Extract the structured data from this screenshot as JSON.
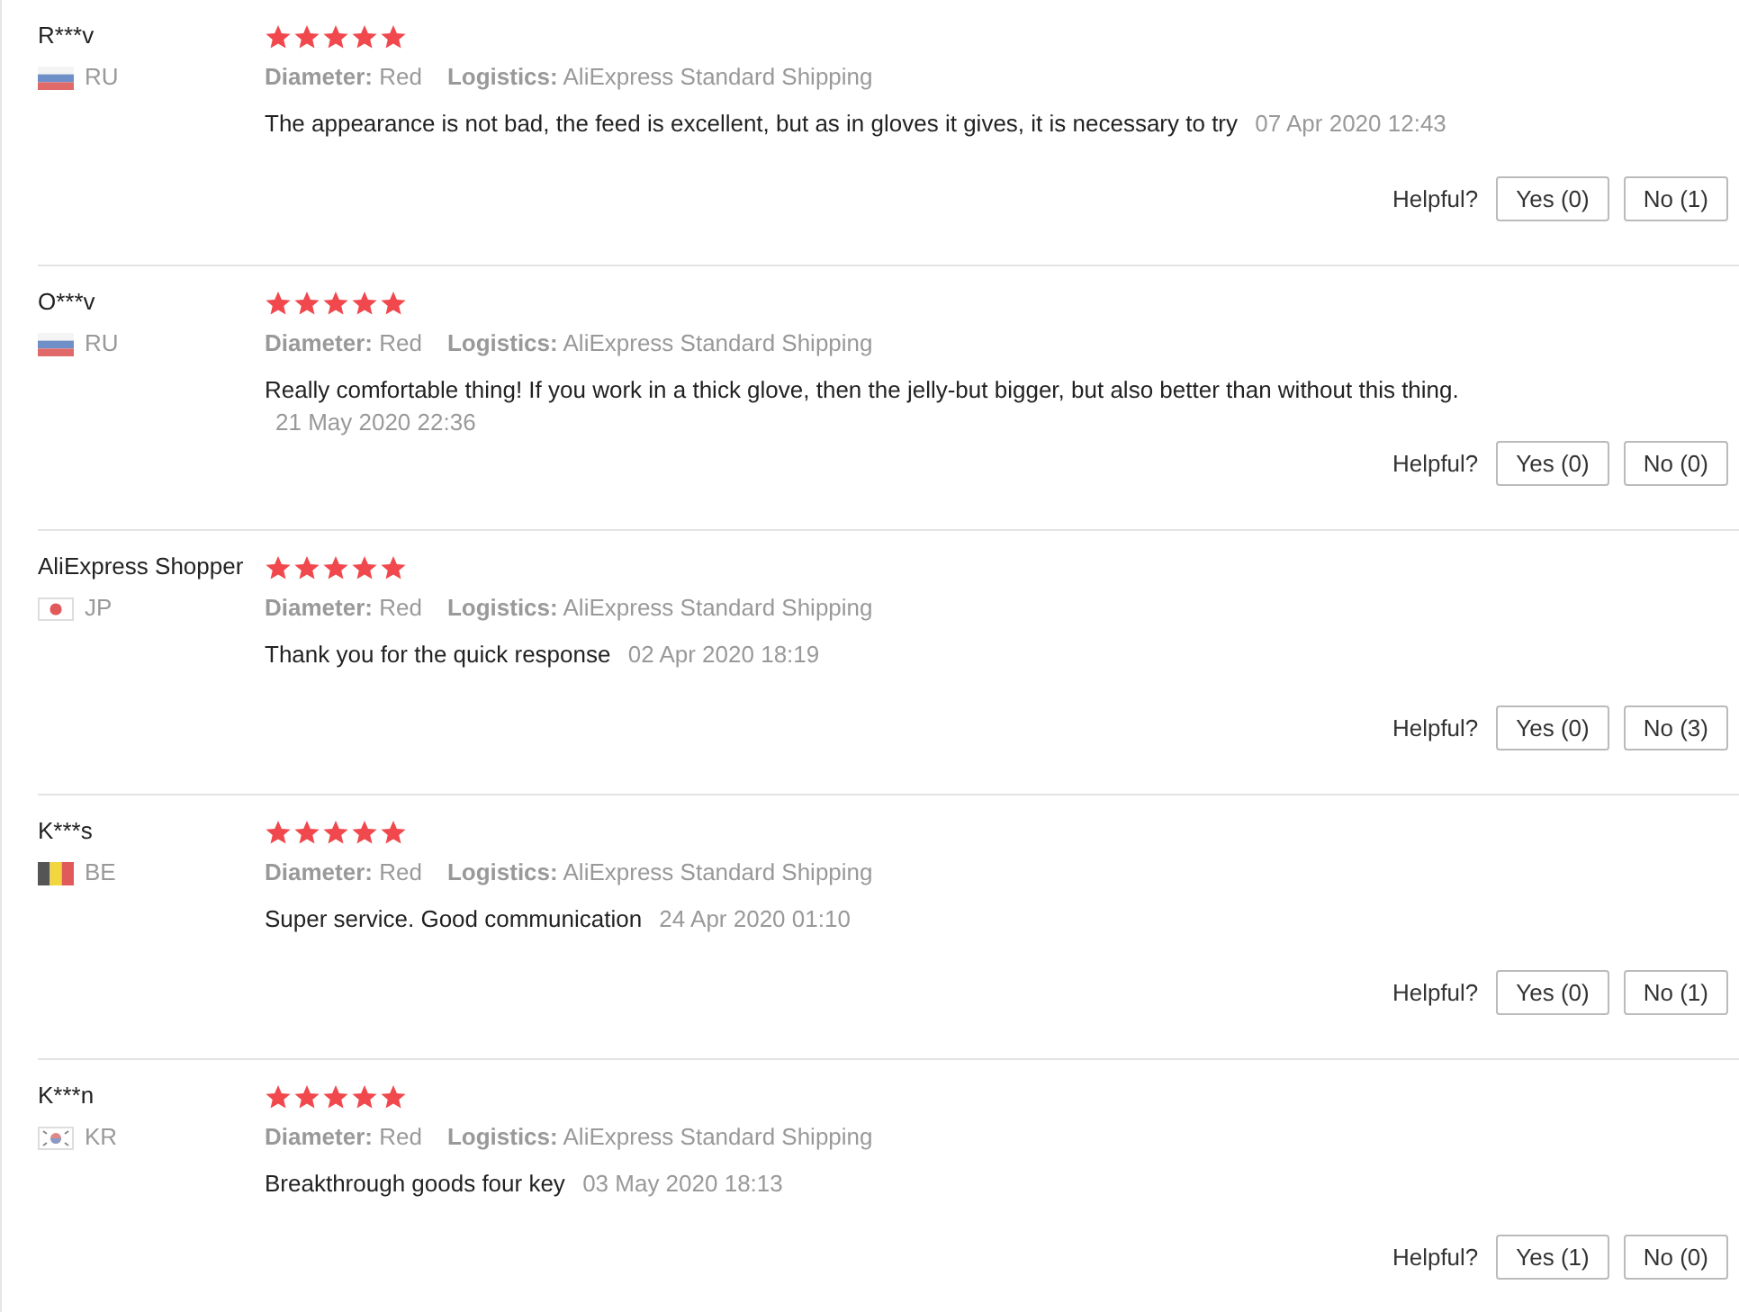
{
  "reviews": [
    {
      "user": "R***v",
      "kind": "ru",
      "country": "RU",
      "stars": 5,
      "diameter_label": "Diameter:",
      "diameter": "Red",
      "logistics_label": "Logistics:",
      "logistics": "AliExpress Standard Shipping",
      "text": "The appearance is not bad, the feed is excellent, but as in gloves it gives, it is necessary to try",
      "date": "07 Apr 2020 12:43",
      "helpful": "Helpful?",
      "yes": "Yes (0)",
      "no": "No (1)"
    },
    {
      "user": "O***v",
      "kind": "ru",
      "country": "RU",
      "stars": 5,
      "diameter_label": "Diameter:",
      "diameter": "Red",
      "logistics_label": "Logistics:",
      "logistics": "AliExpress Standard Shipping",
      "text": "Really comfortable thing! If you work in a thick glove, then the jelly-but bigger, but also better than without this thing.",
      "date": "21 May 2020 22:36",
      "helpful": "Helpful?",
      "yes": "Yes (0)",
      "no": "No (0)"
    },
    {
      "user": "AliExpress Shopper",
      "kind": "jp",
      "country": "JP",
      "stars": 5,
      "diameter_label": "Diameter:",
      "diameter": "Red",
      "logistics_label": "Logistics:",
      "logistics": "AliExpress Standard Shipping",
      "text": "Thank you for the quick response",
      "date": "02 Apr 2020 18:19",
      "helpful": "Helpful?",
      "yes": "Yes (0)",
      "no": "No (3)"
    },
    {
      "user": "K***s",
      "kind": "be",
      "country": "BE",
      "stars": 5,
      "diameter_label": "Diameter:",
      "diameter": "Red",
      "logistics_label": "Logistics:",
      "logistics": "AliExpress Standard Shipping",
      "text": "Super service. Good communication",
      "date": "24 Apr 2020 01:10",
      "helpful": "Helpful?",
      "yes": "Yes (0)",
      "no": "No (1)"
    },
    {
      "user": "K***n",
      "kind": "kr",
      "country": "KR",
      "stars": 5,
      "diameter_label": "Diameter:",
      "diameter": "Red",
      "logistics_label": "Logistics:",
      "logistics": "AliExpress Standard Shipping",
      "text": "Breakthrough goods four key",
      "date": "03 May 2020 18:13",
      "helpful": "Helpful?",
      "yes": "Yes (1)",
      "no": "No (0)"
    }
  ]
}
